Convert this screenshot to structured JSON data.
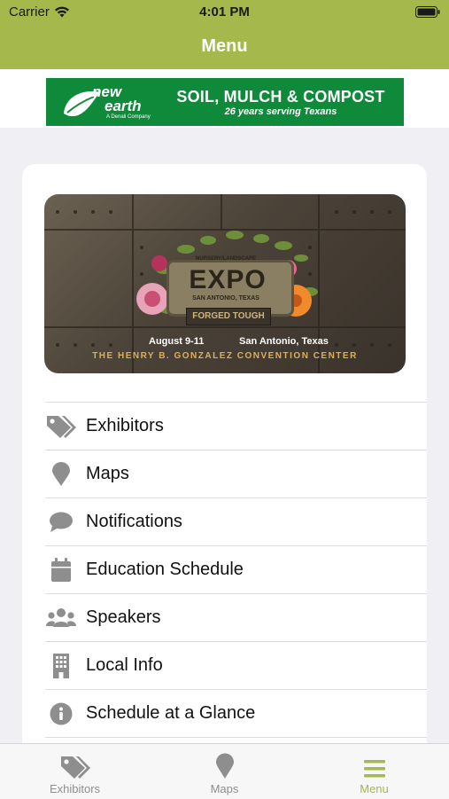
{
  "status_bar": {
    "carrier": "Carrier",
    "time": "4:01 PM"
  },
  "header": {
    "title": "Menu"
  },
  "ad": {
    "logo_new": "new",
    "logo_earth": "earth",
    "logo_sub": "A Denali Company",
    "headline": "SOIL, MULCH & COMPOST",
    "tagline": "26 years serving Texans",
    "bg_color": "#0e8a3a"
  },
  "banner": {
    "pre_title": "NURSERY/LANDSCAPE",
    "title": "EXPO",
    "location_small": "SAN ANTONIO, TEXAS",
    "subtitle": "FORGED TOUGH",
    "dates": "August 9-11",
    "city": "San Antonio, Texas",
    "venue": "THE HENRY B. GONZALEZ CONVENTION CENTER"
  },
  "menu": {
    "items": [
      {
        "label": "Exhibitors",
        "icon": "tags-icon"
      },
      {
        "label": "Maps",
        "icon": "map-pin-icon"
      },
      {
        "label": "Notifications",
        "icon": "chat-bubble-icon"
      },
      {
        "label": "Education Schedule",
        "icon": "calendar-icon"
      },
      {
        "label": "Speakers",
        "icon": "users-icon"
      },
      {
        "label": "Local Info",
        "icon": "building-icon"
      },
      {
        "label": "Schedule at a Glance",
        "icon": "info-icon"
      }
    ]
  },
  "tabs": [
    {
      "label": "Exhibitors",
      "icon": "tags-icon",
      "active": false
    },
    {
      "label": "Maps",
      "icon": "map-pin-icon",
      "active": false
    },
    {
      "label": "Menu",
      "icon": "hamburger-icon",
      "active": true
    }
  ],
  "colors": {
    "accent": "#a4b84b",
    "icon_gray": "#8e8e8e"
  }
}
